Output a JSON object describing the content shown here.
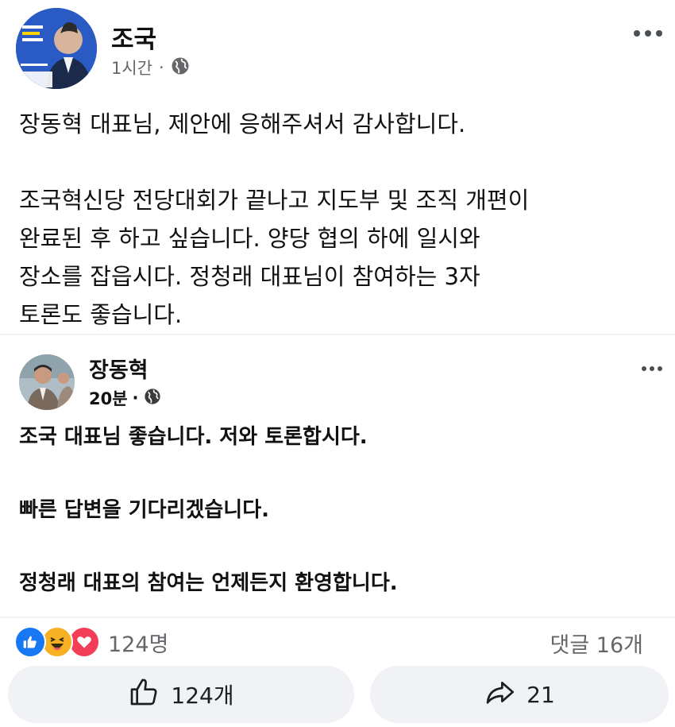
{
  "post": {
    "author": "조국",
    "time": "1시간",
    "separator": "·",
    "body": "장동혁 대표님, 제안에 응해주셔서 감사합니다.\n\n조국혁신당 전당대회가 끝나고 지도부 및 조직 개편이\n완료된 후 하고 싶습니다. 양당 협의 하에 일시와\n장소를 잡읍시다. 정청래 대표님이 참여하는 3자\n토론도 좋습니다."
  },
  "shared": {
    "author": "장동혁",
    "time": "20분",
    "separator": "·",
    "body": "조국 대표님 좋습니다. 저와 토론합시다.\n\n빠른 답변을 기다리겠습니다.\n\n정청래 대표의 참여는 언제든지 환영합니다."
  },
  "stats": {
    "reactions": "124명",
    "comments": "댓글 16개"
  },
  "actions": {
    "like": "124개",
    "share": "21"
  },
  "colors": {
    "like_blue": "#1877f2",
    "love_red": "#f33e58",
    "haha_yellow": "#f7b125"
  },
  "icons": [
    "globe-icon",
    "more-icon",
    "like-icon",
    "haha-icon",
    "love-icon",
    "thumbs-up-icon",
    "share-arrow-icon"
  ]
}
